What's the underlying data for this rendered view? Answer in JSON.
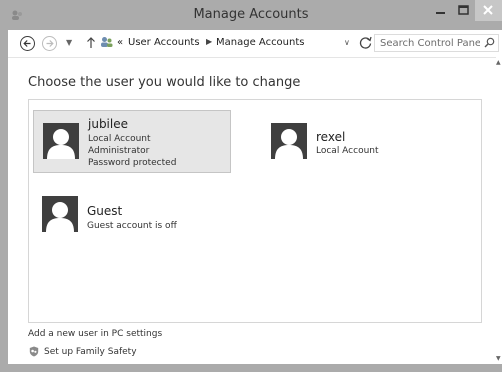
{
  "window": {
    "title": "Manage Accounts"
  },
  "address": {
    "prefix": "«",
    "crumbs": [
      "User Accounts",
      "Manage Accounts"
    ],
    "search_placeholder": "Search Control Panel"
  },
  "main": {
    "heading": "Choose the user you would like to change",
    "accounts": [
      {
        "name": "jubilee",
        "lines": [
          "Local Account",
          "Administrator",
          "Password protected"
        ],
        "selected": true
      },
      {
        "name": "rexel",
        "lines": [
          "Local Account"
        ],
        "selected": false
      },
      {
        "name": "Guest",
        "lines": [
          "Guest account is off"
        ],
        "selected": false
      }
    ],
    "links": {
      "add_user": "Add a new user in PC settings",
      "family_safety": "Set up Family Safety"
    }
  },
  "colors": {
    "chrome": "#ababab",
    "selection": "#e6e6e6",
    "avatar": "#3f3f3f"
  },
  "icons": [
    "back-arrow-icon",
    "forward-arrow-icon",
    "up-arrow-icon",
    "user-accounts-icon",
    "refresh-icon",
    "search-icon",
    "shield-icon",
    "user-avatar-icon"
  ]
}
